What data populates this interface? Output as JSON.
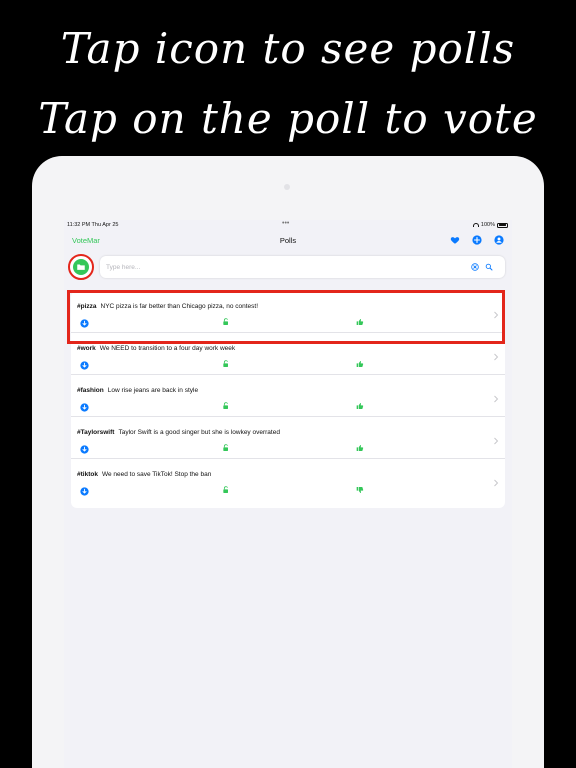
{
  "caption": {
    "line1": "Tap icon to see polls",
    "line2": "Tap on the poll to vote"
  },
  "status_bar": {
    "time_date": "11:32 PM   Thu Apr 25",
    "dots": "•••",
    "battery": "100%"
  },
  "nav": {
    "back_label": "VoteMar",
    "title": "Polls"
  },
  "search": {
    "placeholder": "Type here...",
    "value": ""
  },
  "polls": [
    {
      "tag": "#pizza",
      "text": "NYC pizza is far better than Chicago pizza, no contest!",
      "vote": "thumbs-up"
    },
    {
      "tag": "#work",
      "text": "We NEED to transition to a four day work week",
      "vote": "thumbs-up"
    },
    {
      "tag": "#fashion",
      "text": "Low rise jeans are back in style",
      "vote": "thumbs-up"
    },
    {
      "tag": "#Taylorswift",
      "text": "Taylor Swift is a good singer but she is lowkey overrated",
      "vote": "thumbs-up"
    },
    {
      "tag": "#tiktok",
      "text": "We need to save TikTok! Stop the ban",
      "vote": "thumbs-down"
    }
  ],
  "colors": {
    "accent_green": "#34c759",
    "accent_blue": "#0a7aff",
    "highlight_red": "#e3261b"
  }
}
